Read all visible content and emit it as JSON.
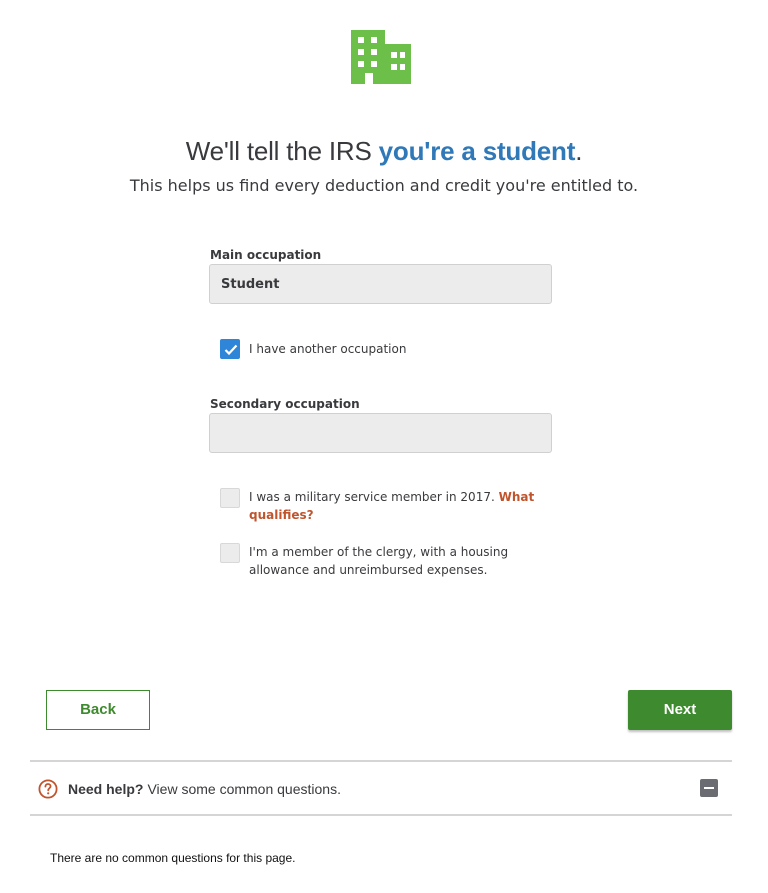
{
  "header": {
    "icon": "building-icon",
    "title_prefix": "We'll tell the IRS ",
    "title_highlight": "you're a student",
    "title_suffix": ".",
    "subtitle": "This helps us find every deduction and credit you're entitled to."
  },
  "form": {
    "main_occupation_label": "Main occupation",
    "main_occupation_value": "Student",
    "another_occupation_label": "I have another occupation",
    "another_occupation_checked": true,
    "secondary_occupation_label": "Secondary occupation",
    "secondary_occupation_value": "",
    "military_label": "I was a military service member in 2017.",
    "military_link": "What qualifies?",
    "military_checked": false,
    "clergy_label": "I'm a member of the clergy, with a housing allowance and unreimbursed expenses.",
    "clergy_checked": false
  },
  "nav": {
    "back_label": "Back",
    "next_label": "Next"
  },
  "help": {
    "icon": "question-circle-icon",
    "title": "Need help?",
    "text": "View some common questions.",
    "toggle_icon": "minus-square-icon",
    "empty_message": "There are no common questions for this page."
  },
  "colors": {
    "brand_green": "#3e8a2e",
    "logo_green": "#6cc04a",
    "highlight_blue": "#2f79b9",
    "checkbox_blue": "#2f86d8",
    "link_orange": "#c0542d"
  }
}
